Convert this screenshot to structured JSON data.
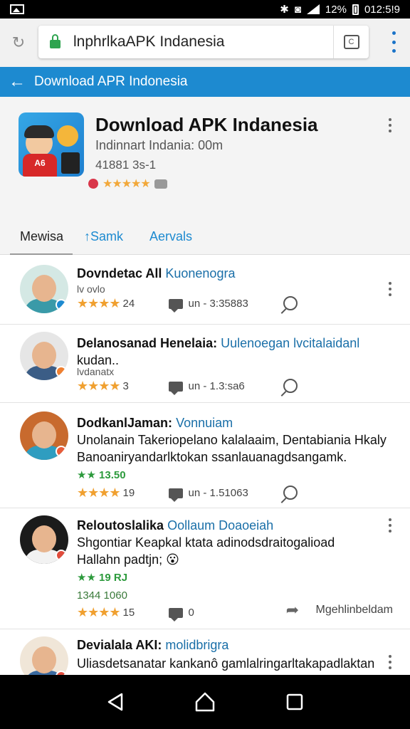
{
  "status_bar": {
    "battery": "12%",
    "time": "012:5!9"
  },
  "browser": {
    "url": "lnphrlkaAPK Indanesia",
    "tab_count": "C"
  },
  "app_bar": {
    "title": "Download APR Indonesia"
  },
  "app": {
    "title": "Download APK Indanesia",
    "subtitle": "Indinnart Indania: 00m",
    "version": "41881 3s-1",
    "rating_stars": "★★★★★",
    "icon_text": "A6"
  },
  "tabs": [
    {
      "label": "Mewisa"
    },
    {
      "label": "↑Samk"
    },
    {
      "label": "Aervals"
    }
  ],
  "reviews": [
    {
      "name": "Dovndetac All",
      "name_link": "Kuonenogra",
      "small": "lv ovlo",
      "stars": "★★★★",
      "count": "24",
      "date": "un - 3:35883",
      "avatar_color": "#3a9aa8",
      "badge_color": "#1d8ad0"
    },
    {
      "name": "Delanosanad Henelaia:",
      "name_link": "Uulenoegan lvcitalaidanl",
      "line1": "kudan..",
      "small": "lvdanatx",
      "stars": "★★★★",
      "count": "3",
      "date": "un - 1.3:sa6",
      "avatar_color": "#3b5d86",
      "badge_color": "#f08030"
    },
    {
      "name": "DodkanlJaman:",
      "name_link": "Vonnuiam",
      "line1": "Unolanain Takeriopelano kalalaaim, Dentabiania Hkaly",
      "line2": "Banoaniryandarlktokan ssanlauanagdsangamk.",
      "green": "★★ 13.50",
      "stars": "★★★★",
      "count": "19",
      "date": "un - 1.51063",
      "avatar_color": "#2f9dc0",
      "badge_color": "#e85c3a"
    },
    {
      "name": "Reloutoslalika",
      "name_link": "Oollaum Doaoeiah",
      "line1": "Shgontiar Keapkal ktata adinodsdraitogalioad",
      "line2": "Hallahn padtjn; 😮",
      "green": "★★ 19 RJ",
      "green2": "1344 1060",
      "stars": "★★★★",
      "count": "15",
      "date": "0",
      "translate": "Mgehlinbeldam",
      "avatar_color": "#2d2d2d",
      "badge_color": "#e04c3c"
    },
    {
      "name": "Devialala AKI:",
      "name_link": "molidbrigra",
      "line1": "Uliasdetsanatar kankanô gamlalringarltakapadlaktan",
      "avatar_color": "#3a6aa0",
      "badge_color": "#e04c3c"
    }
  ]
}
